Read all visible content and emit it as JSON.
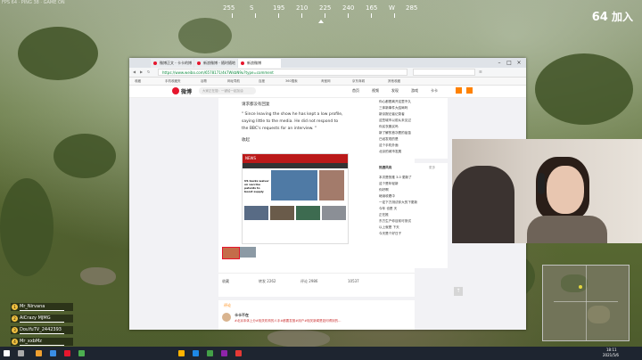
{
  "game": {
    "top_left_text": "FPS 64 · PING 38 · GAME ON",
    "compass_degrees": [
      "255",
      "S",
      "195",
      "210",
      "225",
      "240",
      "165",
      "W",
      "285"
    ],
    "alive_count": "64",
    "alive_label": "加入",
    "team": [
      {
        "number": "1",
        "name": "Mr_Nirvana"
      },
      {
        "number": "2",
        "name": "AiCrazy MJMG"
      },
      {
        "number": "3",
        "name": "DouYuTV_2442393"
      },
      {
        "number": "4",
        "name": "Mr_xxbMz"
      }
    ]
  },
  "browser": {
    "tabs": [
      "微博正文 - 卡卡的博客",
      "新浪微博 - 随时随地",
      "新浪微博"
    ],
    "url": "https://www.weibo.com/6578171/4k7WkbN9u?type=comment",
    "bookmarks": [
      "收藏",
      "手机收藏夹",
      "谷歌",
      "网址导航",
      "百度",
      "360搜索",
      "淘宝网",
      "京东商城",
      "其他收藏"
    ]
  },
  "weibo": {
    "logo_text": "微博",
    "search_placeholder": "大家正在搜：一键给一起加油",
    "nav": [
      "首页",
      "视频",
      "发现",
      "游戏",
      "卡卡"
    ],
    "post_lines": [
      "请求都没有回复",
      "\" Since leaving the show he has kept a low profile,",
      "saying little to the media. He did not respond to",
      "the BBC's requests for an interview. \""
    ],
    "expand_label": "收起",
    "bbc_banner": "NEWS",
    "news_headline": "US backs waiver on vaccine patents to boost supply",
    "actions": {
      "collect": "收藏",
      "repost": "转发 2262",
      "comment": "评论 2986",
      "like": "10537"
    },
    "hot_title": "相关推荐",
    "comment_section": "评论",
    "comment_user": "卡卡不在",
    "comment_text": "#北京本体上分#相关机构的人手#都要发推#用户#相关新闻是如何得到的...",
    "sidebar_top": [
      "你心都是离开这里不久",
      "三体新事件大结局吗",
      "新京报记者记录者",
      "这些城市以前从未见过",
      "你买衣服买吗",
      "新了解的首次看的疫苗",
      "已经发现的是",
      "这个手机外面",
      "北京的城市发展"
    ],
    "sidebar_hot_title": "热搜风向",
    "sidebar_hot_more": "更多",
    "sidebar_hot": [
      "本次是快推 3.0 更新了",
      "这个是年轻新",
      "你好啊",
      "继续收看中",
      "一定下方测试你大的下更新",
      "今年 也是 天",
      "正在推",
      "东方生产你目前可测试",
      "以上就是 下天",
      "今天是个好日子"
    ]
  },
  "taskbar": {
    "time": "18:11",
    "date": "2021/5/6"
  },
  "colors": {
    "weibo_red": "#e6162d",
    "weibo_orange": "#ff8200",
    "bbc_red": "#bb1919"
  }
}
